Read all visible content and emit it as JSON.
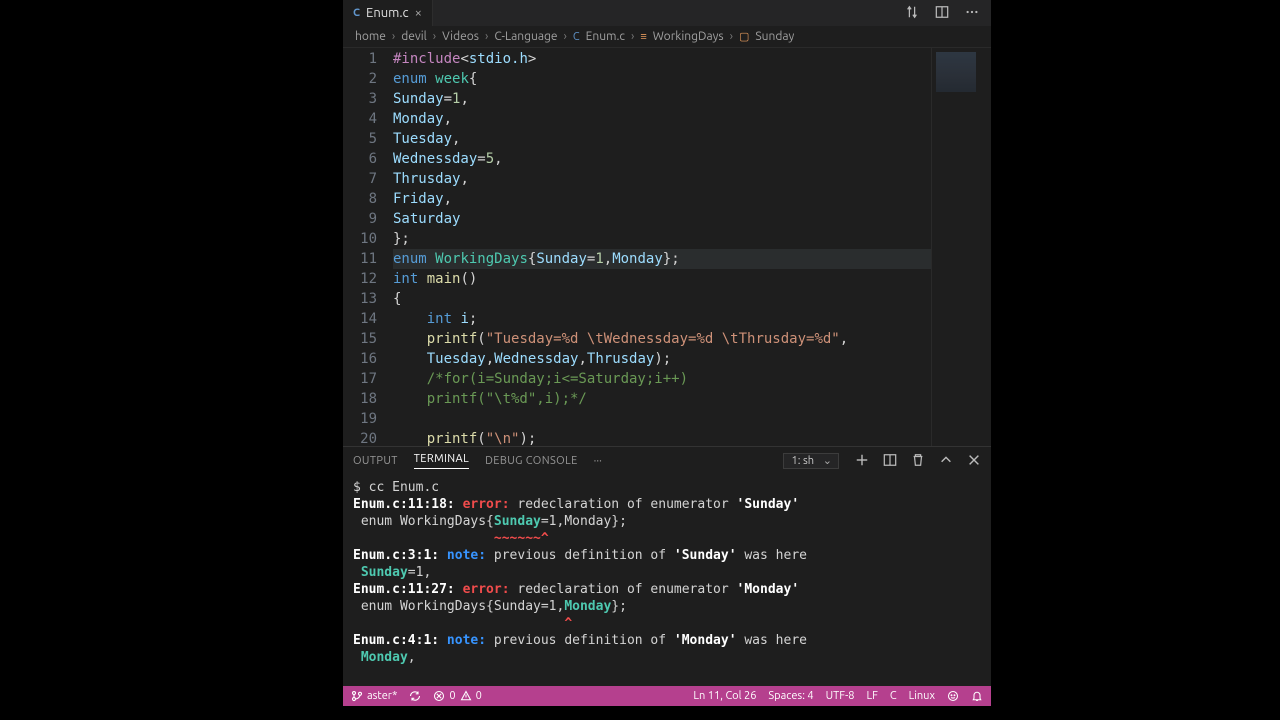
{
  "tab": {
    "filename": "Enum.c",
    "lang_icon": "C"
  },
  "breadcrumb": {
    "parts": [
      "home",
      "devil",
      "Videos",
      "C-Language",
      "Enum.c",
      "WorkingDays",
      "Sunday"
    ]
  },
  "code": {
    "lines": [
      {
        "n": "1",
        "tokens": [
          [
            "tk-pp",
            "#include"
          ],
          [
            "tk-pl",
            "<"
          ],
          [
            "tk-id",
            "stdio.h"
          ],
          [
            "tk-pl",
            ">"
          ]
        ]
      },
      {
        "n": "2",
        "tokens": [
          [
            "tk-kw",
            "enum"
          ],
          [
            "tk-pl",
            " "
          ],
          [
            "tk-type",
            "week"
          ],
          [
            "tk-pl",
            "{"
          ]
        ]
      },
      {
        "n": "3",
        "tokens": [
          [
            "tk-id",
            "Sunday"
          ],
          [
            "tk-pl",
            "="
          ],
          [
            "tk-num",
            "1"
          ],
          [
            "tk-pl",
            ","
          ]
        ]
      },
      {
        "n": "4",
        "tokens": [
          [
            "tk-id",
            "Monday"
          ],
          [
            "tk-pl",
            ","
          ]
        ]
      },
      {
        "n": "5",
        "tokens": [
          [
            "tk-id",
            "Tuesday"
          ],
          [
            "tk-pl",
            ","
          ]
        ]
      },
      {
        "n": "6",
        "tokens": [
          [
            "tk-id",
            "Wednessday"
          ],
          [
            "tk-pl",
            "="
          ],
          [
            "tk-num",
            "5"
          ],
          [
            "tk-pl",
            ","
          ]
        ]
      },
      {
        "n": "7",
        "tokens": [
          [
            "tk-id",
            "Thrusday"
          ],
          [
            "tk-pl",
            ","
          ]
        ]
      },
      {
        "n": "8",
        "tokens": [
          [
            "tk-id",
            "Friday"
          ],
          [
            "tk-pl",
            ","
          ]
        ]
      },
      {
        "n": "9",
        "tokens": [
          [
            "tk-id",
            "Saturday"
          ]
        ]
      },
      {
        "n": "10",
        "tokens": [
          [
            "tk-pl",
            "};"
          ]
        ]
      },
      {
        "n": "11",
        "hl": true,
        "tokens": [
          [
            "tk-kw",
            "enum"
          ],
          [
            "tk-pl",
            " "
          ],
          [
            "tk-type",
            "WorkingDays"
          ],
          [
            "tk-pl",
            "{"
          ],
          [
            "tk-id",
            "Sunday"
          ],
          [
            "tk-pl",
            "="
          ],
          [
            "tk-num",
            "1"
          ],
          [
            "tk-pl",
            ","
          ],
          [
            "tk-id",
            "Monday"
          ],
          [
            "tk-pl",
            "};"
          ]
        ]
      },
      {
        "n": "12",
        "tokens": [
          [
            "tk-kw",
            "int"
          ],
          [
            "tk-pl",
            " "
          ],
          [
            "tk-fn",
            "main"
          ],
          [
            "tk-pl",
            "()"
          ]
        ]
      },
      {
        "n": "13",
        "tokens": [
          [
            "tk-pl",
            "{"
          ]
        ]
      },
      {
        "n": "14",
        "tokens": [
          [
            "tk-pl",
            "    "
          ],
          [
            "tk-kw",
            "int"
          ],
          [
            "tk-pl",
            " "
          ],
          [
            "tk-id",
            "i"
          ],
          [
            "tk-pl",
            ";"
          ]
        ]
      },
      {
        "n": "15",
        "tokens": [
          [
            "tk-pl",
            "    "
          ],
          [
            "tk-fn",
            "printf"
          ],
          [
            "tk-pl",
            "("
          ],
          [
            "tk-str",
            "\"Tuesday=%d \\tWednessday=%d \\tThrusday=%d\""
          ],
          [
            "tk-pl",
            ","
          ]
        ]
      },
      {
        "n": "16",
        "tokens": [
          [
            "tk-pl",
            "    "
          ],
          [
            "tk-id",
            "Tuesday"
          ],
          [
            "tk-pl",
            ","
          ],
          [
            "tk-id",
            "Wednessday"
          ],
          [
            "tk-pl",
            ","
          ],
          [
            "tk-id",
            "Thrusday"
          ],
          [
            "tk-pl",
            ");"
          ]
        ]
      },
      {
        "n": "17",
        "tokens": [
          [
            "tk-pl",
            "    "
          ],
          [
            "tk-cm",
            "/*for(i=Sunday;i<=Saturday;i++)"
          ]
        ]
      },
      {
        "n": "18",
        "tokens": [
          [
            "tk-pl",
            "    "
          ],
          [
            "tk-cm",
            "printf(\"\\t%d\",i);*/"
          ]
        ]
      },
      {
        "n": "19",
        "tokens": [
          [
            "tk-pl",
            " "
          ]
        ]
      },
      {
        "n": "20",
        "tokens": [
          [
            "tk-pl",
            "    "
          ],
          [
            "tk-fn",
            "printf"
          ],
          [
            "tk-pl",
            "("
          ],
          [
            "tk-str",
            "\"\\n\""
          ],
          [
            "tk-pl",
            ");"
          ]
        ]
      }
    ]
  },
  "panel": {
    "tabs": {
      "output": "OUTPUT",
      "terminal": "TERMINAL",
      "debug": "DEBUG CONSOLE"
    },
    "shell_label": "1: sh"
  },
  "terminal": {
    "lines": [
      [
        [
          "t-white",
          "$ cc Enum.c"
        ]
      ],
      [
        [
          "t-wbold",
          "Enum.c:11:18: "
        ],
        [
          "t-err",
          "error:"
        ],
        [
          "t-white",
          " redeclaration of enumerator "
        ],
        [
          "t-wbold",
          "'Sunday'"
        ]
      ],
      [
        [
          "t-white",
          " enum WorkingDays{"
        ],
        [
          "t-green",
          "Sunday"
        ],
        [
          "t-white",
          "=1,Monday};"
        ]
      ],
      [
        [
          "t-white",
          "                  "
        ],
        [
          "t-err",
          "~~~~~~^"
        ]
      ],
      [
        [
          "t-wbold",
          "Enum.c:3:1: "
        ],
        [
          "t-note",
          "note:"
        ],
        [
          "t-white",
          " previous definition of "
        ],
        [
          "t-wbold",
          "'Sunday'"
        ],
        [
          "t-white",
          " was here"
        ]
      ],
      [
        [
          "t-white",
          " "
        ],
        [
          "t-green",
          "Sunday"
        ],
        [
          "t-white",
          "=1,"
        ]
      ],
      [
        [
          "t-white",
          ""
        ]
      ],
      [
        [
          "t-wbold",
          "Enum.c:11:27: "
        ],
        [
          "t-err",
          "error:"
        ],
        [
          "t-white",
          " redeclaration of enumerator "
        ],
        [
          "t-wbold",
          "'Monday'"
        ]
      ],
      [
        [
          "t-white",
          " enum WorkingDays{Sunday=1,"
        ],
        [
          "t-green",
          "Monday"
        ],
        [
          "t-white",
          "};"
        ]
      ],
      [
        [
          "t-white",
          "                           "
        ],
        [
          "t-err",
          "^"
        ]
      ],
      [
        [
          "t-wbold",
          "Enum.c:4:1: "
        ],
        [
          "t-note",
          "note:"
        ],
        [
          "t-white",
          " previous definition of "
        ],
        [
          "t-wbold",
          "'Monday'"
        ],
        [
          "t-white",
          " was here"
        ]
      ],
      [
        [
          "t-white",
          " "
        ],
        [
          "t-green",
          "Monday"
        ],
        [
          "t-white",
          ","
        ]
      ]
    ]
  },
  "status": {
    "branch": "aster*",
    "errors": "0",
    "warnings": "0",
    "ln_col": "Ln 11, Col 26",
    "spaces": "Spaces: 4",
    "encoding": "UTF-8",
    "eol": "LF",
    "lang": "C",
    "os": "Linux"
  }
}
